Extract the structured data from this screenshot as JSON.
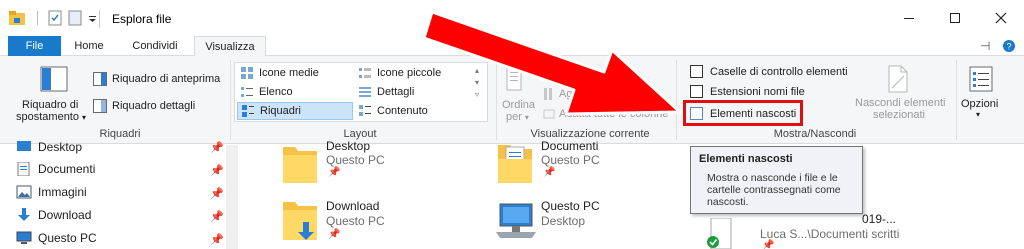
{
  "window": {
    "title": "Esplora file",
    "minimize_icon": "minimize-icon",
    "maximize_icon": "maximize-icon",
    "close_icon": "close-icon"
  },
  "tabs": [
    {
      "label": "File"
    },
    {
      "label": "Home"
    },
    {
      "label": "Condividi"
    },
    {
      "label": "Visualizza"
    }
  ],
  "ribbon": {
    "riquadri": {
      "group_label": "Riquadri",
      "nav_pane_line1": "Riquadro di",
      "nav_pane_line2": "spostamento",
      "preview": "Riquadro di anteprima",
      "details": "Riquadro dettagli"
    },
    "layout": {
      "group_label": "Layout",
      "items": [
        "Icone medie",
        "Icone piccole",
        "Elenco",
        "Dettagli",
        "Riquadri",
        "Contenuto"
      ],
      "selected": "Riquadri"
    },
    "current_view": {
      "group_label": "Visualizzazione corrente",
      "sort_line1": "Ordina",
      "sort_line2": "per",
      "add_columns": "Aggiun",
      "fit_columns": "Adatta tutte le colonne"
    },
    "show_hide": {
      "group_label": "Mostra/Nascondi",
      "checkboxes": [
        "Caselle di controllo elementi",
        "Estensioni nomi file",
        "Elementi nascosti"
      ],
      "hide_selected_line1": "Nascondi elementi",
      "hide_selected_line2": "selezionati"
    },
    "options_label": "Opzioni"
  },
  "nav": {
    "items": [
      "Desktop",
      "Documenti",
      "Immagini",
      "Download",
      "Questo PC"
    ]
  },
  "files": [
    {
      "name": "Desktop",
      "sub": "Questo PC"
    },
    {
      "name": "Documenti",
      "sub": "Questo PC"
    },
    {
      "name": "Download",
      "sub": "Questo PC"
    },
    {
      "name": "Questo PC",
      "sub": "Desktop"
    },
    {
      "name": "019-...",
      "sub": "Luca S...\\Documenti scritti"
    }
  ],
  "tooltip": {
    "title": "Elementi nascosti",
    "body": "Mostra o nasconde i file e le cartelle contrassegnati come nascosti."
  },
  "colors": {
    "file_tab": "#1979ca",
    "highlight": "#e01010",
    "arrow": "#ff0000"
  }
}
